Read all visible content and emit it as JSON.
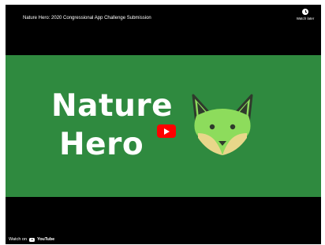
{
  "video": {
    "title": "Nature Hero: 2020 Congressional App Challenge Submission",
    "watch_later_label": "Watch later",
    "thumbnail_line1": "Nature",
    "thumbnail_line2": "Hero",
    "watch_on_label": "Watch on",
    "youtube_label": "YouTube"
  },
  "icons": {
    "watch_later": "clock-icon",
    "play": "play-icon",
    "youtube_logo": "youtube-logo-icon",
    "fox": "fox-icon"
  },
  "colors": {
    "background": "#000000",
    "thumbnail_green": "#2f8a3f",
    "fox_green": "#8ddc5c",
    "fox_cream": "#e8d78a",
    "fox_dark": "#2f3a2c",
    "play_red": "#ff0000",
    "text_white": "#ffffff"
  }
}
